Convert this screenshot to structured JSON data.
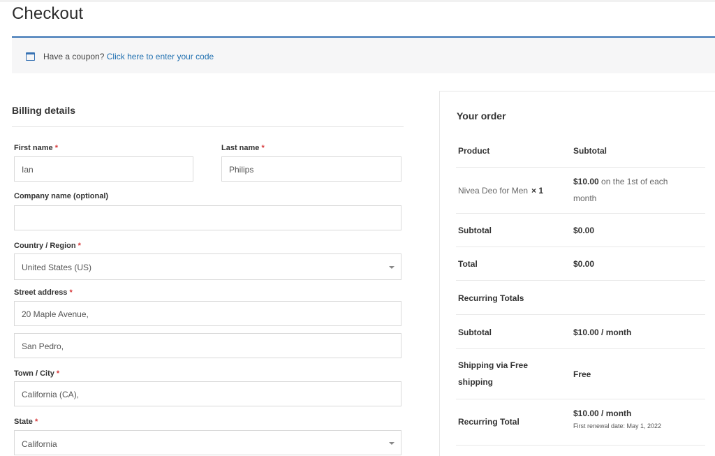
{
  "page": {
    "title": "Checkout"
  },
  "coupon": {
    "prompt": "Have a coupon?",
    "link": "Click here to enter your code"
  },
  "billing": {
    "title": "Billing details",
    "required_marker": "*",
    "fields": {
      "first_name": {
        "label": "First name",
        "value": "Ian"
      },
      "last_name": {
        "label": "Last name",
        "value": "Philips"
      },
      "company": {
        "label": "Company name (optional)",
        "value": ""
      },
      "country": {
        "label": "Country / Region",
        "value": "United States (US)"
      },
      "street": {
        "label": "Street address",
        "value_1": "20 Maple Avenue,",
        "value_2": "San Pedro,"
      },
      "city": {
        "label": "Town / City",
        "value": "California (CA),"
      },
      "state": {
        "label": "State",
        "value": "California"
      }
    }
  },
  "order": {
    "title": "Your order",
    "header": {
      "product": "Product",
      "subtotal": "Subtotal"
    },
    "item": {
      "name": "Nivea Deo for Men",
      "qty": "× 1",
      "price": "$10.00",
      "price_desc_1": "on the 1st of each",
      "price_desc_2": "month"
    },
    "subtotal": {
      "label": "Subtotal",
      "value": "$0.00"
    },
    "total": {
      "label": "Total",
      "value": "$0.00"
    },
    "recurring_totals": {
      "label": "Recurring Totals"
    },
    "recurring_subtotal": {
      "label": "Subtotal",
      "value": "$10.00 / month"
    },
    "shipping": {
      "label_1": "Shipping via Free",
      "label_2": "shipping",
      "value": "Free"
    },
    "recurring_total": {
      "label": "Recurring Total",
      "value": "$10.00 / month",
      "renewal": "First renewal date: May 1, 2022"
    }
  }
}
